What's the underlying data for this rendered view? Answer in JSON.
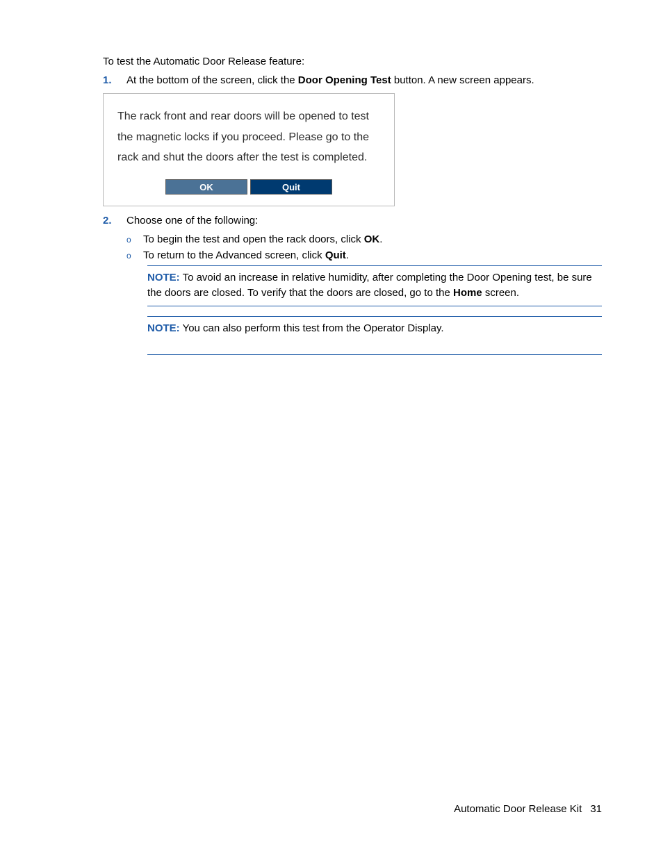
{
  "intro": "To test the Automatic Door Release feature:",
  "step1": {
    "num": "1.",
    "pre": "At the bottom of the screen, click the ",
    "bold": "Door Opening Test",
    "post": " button. A new screen appears."
  },
  "dialog": {
    "text": "The rack front and rear doors will be opened to test the magnetic locks if you proceed. Please go to the rack and shut the doors after the test is completed.",
    "ok": "OK",
    "quit": "Quit"
  },
  "step2": {
    "num": "2.",
    "text": "Choose one of the following:",
    "a_pre": "To begin the test and open the rack doors, click ",
    "a_bold": "OK",
    "a_post": ".",
    "b_pre": "To return to the Advanced screen, click ",
    "b_bold": "Quit",
    "b_post": "."
  },
  "note1": {
    "label": "NOTE:",
    "pre": "  To avoid an increase in relative humidity, after completing the Door Opening test, be sure the doors are closed. To verify that the doors are closed, go to the ",
    "bold": "Home",
    "post": " screen."
  },
  "note2": {
    "label": "NOTE:",
    "text": "  You can also perform this test from the Operator Display."
  },
  "footer": {
    "title": "Automatic Door Release Kit",
    "page": "31"
  },
  "bullet": "o"
}
